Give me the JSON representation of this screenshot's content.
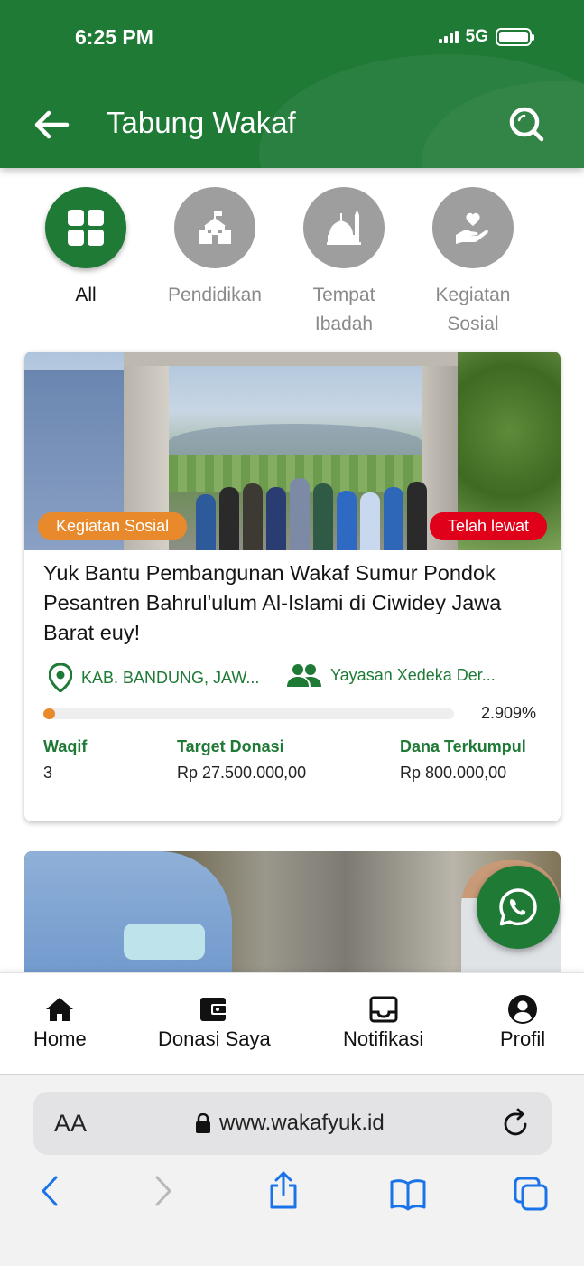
{
  "status_bar": {
    "time": "6:25 PM",
    "network": "5G"
  },
  "header": {
    "title": "Tabung Wakaf",
    "back_icon": "back-arrow-icon",
    "search_icon": "search-icon"
  },
  "categories": [
    {
      "label": "All",
      "icon": "grid-icon",
      "active": true
    },
    {
      "label": "Pendidikan",
      "icon": "school-icon",
      "active": false
    },
    {
      "label": "Tempat Ibadah",
      "icon": "mosque-icon",
      "active": false
    },
    {
      "label": "Kegiatan Sosial",
      "icon": "charity-hand-icon",
      "active": false
    }
  ],
  "campaigns": [
    {
      "category_tag": "Kegiatan Sosial",
      "status_tag": "Telah lewat",
      "title": "Yuk Bantu Pembangunan Wakaf Sumur Pondok Pesantren Bahrul'ulum Al-Islami di Ciwidey Jawa Barat euy!",
      "location": "KAB. BANDUNG, JAW...",
      "organizer": "Yayasan Xedeka Der...",
      "progress_percent": 2.909,
      "progress_label": "2.909%",
      "stats": {
        "waqif_label": "Waqif",
        "waqif_value": "3",
        "target_label": "Target Donasi",
        "target_value": "Rp 27.500.000,00",
        "collected_label": "Dana Terkumpul",
        "collected_value": "Rp 800.000,00"
      }
    }
  ],
  "bottom_nav": [
    {
      "label": "Home",
      "icon": "home-icon"
    },
    {
      "label": "Donasi Saya",
      "icon": "wallet-icon"
    },
    {
      "label": "Notifikasi",
      "icon": "inbox-icon"
    },
    {
      "label": "Profil",
      "icon": "profile-icon"
    }
  ],
  "browser": {
    "text_size": "AA",
    "url": "www.wakafyuk.id"
  },
  "colors": {
    "primary": "#1f7a36",
    "accent": "#e8892b",
    "status_red": "#e0001a"
  }
}
